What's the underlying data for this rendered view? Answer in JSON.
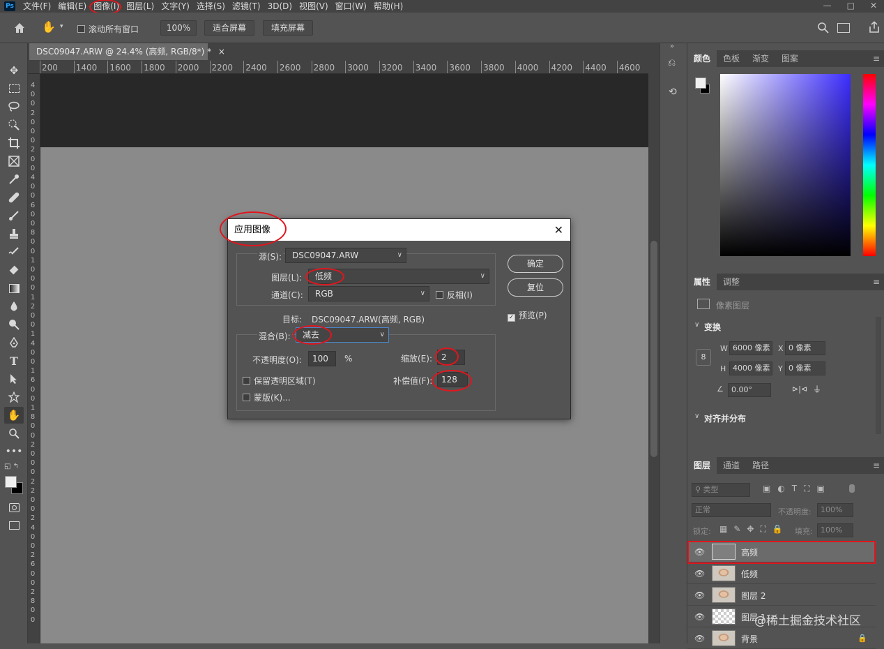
{
  "menubar": {
    "logo": "Ps",
    "items": [
      "文件(F)",
      "编辑(E)",
      "图像(I)",
      "图层(L)",
      "文字(Y)",
      "选择(S)",
      "滤镜(T)",
      "3D(D)",
      "视图(V)",
      "窗口(W)",
      "帮助(H)"
    ],
    "window_controls": [
      "—",
      "□",
      "✕"
    ]
  },
  "optbar": {
    "scroll_all_label": "滚动所有窗口",
    "zoom_value": "100%",
    "fit_screen": "适合屏幕",
    "fill_screen": "填充屏幕"
  },
  "document": {
    "tab_title": "DSC09047.ARW @ 24.4% (高频, RGB/8*) *",
    "tab_close": "×",
    "ruler_top": [
      "200",
      "1400",
      "1600",
      "1800",
      "2000",
      "2200",
      "2400",
      "2600",
      "2800",
      "3000",
      "3200",
      "3400",
      "3600",
      "3800",
      "4000",
      "4200",
      "4400",
      "4600"
    ],
    "ruler_left": [
      "4",
      "0",
      "0",
      "2",
      "0",
      "0",
      "0",
      "2",
      "0",
      "0",
      "4",
      "0",
      "0",
      "6",
      "0",
      "0",
      "8",
      "0",
      "0",
      "1",
      "0",
      "0",
      "0",
      "1",
      "2",
      "0",
      "0",
      "1",
      "4",
      "0",
      "0",
      "1",
      "6",
      "0",
      "0",
      "1",
      "8",
      "0",
      "0",
      "2",
      "0",
      "0",
      "0",
      "2",
      "2",
      "0",
      "0",
      "2",
      "4",
      "0",
      "0",
      "2",
      "6",
      "0",
      "0",
      "2",
      "8",
      "0",
      "0"
    ]
  },
  "dialog": {
    "title": "应用图像",
    "close": "✕",
    "source_label": "源(S):",
    "source_value": "DSC09047.ARW",
    "layer_label": "图层(L):",
    "layer_value": "低频",
    "channel_label": "通道(C):",
    "channel_value": "RGB",
    "invert_label": "反相(I)",
    "target_label": "目标:",
    "target_value": "DSC09047.ARW(高频, RGB)",
    "blending_label": "混合(B):",
    "blending_value": "减去",
    "opacity_label": "不透明度(O):",
    "opacity_value": "100",
    "opacity_unit": "%",
    "scale_label": "缩放(E):",
    "scale_value": "2",
    "offset_label": "补偿值(F):",
    "offset_value": "128",
    "preserve_transparency_label": "保留透明区域(T)",
    "mask_label": "蒙版(K)...",
    "ok": "确定",
    "reset": "复位",
    "preview_label": "预览(P)"
  },
  "color_panel": {
    "tabs": [
      "颜色",
      "色板",
      "渐变",
      "图案"
    ]
  },
  "properties_panel": {
    "tabs": [
      "属性",
      "调整"
    ],
    "pixel_layer": "像素图层",
    "transform_header": "变换",
    "w_label": "W",
    "w_value": "6000 像素",
    "x_label": "X",
    "x_value": "0 像素",
    "h_label": "H",
    "h_value": "4000 像素",
    "y_label": "Y",
    "y_value": "0 像素",
    "angle_value": "0.00°",
    "align_header": "对齐并分布"
  },
  "layers_panel": {
    "tabs": [
      "图层",
      "通道",
      "路径"
    ],
    "filter_kind": "类型",
    "blend_mode": "正常",
    "opacity_label": "不透明度:",
    "opacity_value": "100%",
    "lock_label": "锁定:",
    "fill_label": "填充:",
    "fill_value": "100%",
    "layers": [
      {
        "name": "高频"
      },
      {
        "name": "低频"
      },
      {
        "name": "图层 2"
      },
      {
        "name": "图层 1"
      },
      {
        "name": "背景"
      }
    ]
  },
  "watermark": "@稀土掘金技术社区",
  "colors": {
    "annotation_red": "#e0161e",
    "panel_bg": "#535353",
    "dark_bg": "#424242"
  }
}
